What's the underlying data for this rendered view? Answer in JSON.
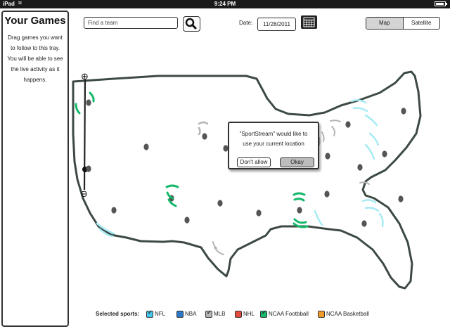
{
  "status_bar": {
    "carrier": "iPad",
    "time": "9:24 PM"
  },
  "tray": {
    "title": "Your Games",
    "description": "Drag games you want to follow to this tray. You will be able to see the live activity as it happens."
  },
  "toolbar": {
    "search_placeholder": "Find a team",
    "date_label": "Date:",
    "date_value": "11/28/2011",
    "map_label": "Map",
    "satellite_label": "Satellite",
    "active_view": "Map"
  },
  "zoom": {
    "plus": "⊕",
    "minus": "⊖"
  },
  "dialog": {
    "message_line1": "\"SportStream\" would like to",
    "message_line2": "use your current location",
    "deny_label": "Don't allow",
    "ok_label": "Okay"
  },
  "sports_filter": {
    "label": "Selected sports:",
    "items": [
      {
        "name": "NFL",
        "color": "#43c9f0",
        "checked": true
      },
      {
        "name": "NBA",
        "color": "#2b78c8",
        "checked": false
      },
      {
        "name": "MLB",
        "color": "#b5b5b5",
        "checked": true
      },
      {
        "name": "NHL",
        "color": "#e24a3b",
        "checked": false
      },
      {
        "name": "NCAA Footbball",
        "color": "#13b86b",
        "checked": true
      },
      {
        "name": "NCAA Basketball",
        "color": "#f09a2a",
        "checked": false
      }
    ]
  },
  "colors": {
    "nfl": "#43c9f0",
    "mlb": "#b5b5b5",
    "ncaa_football": "#13b86b",
    "ink": "#333333",
    "map_border": "#3d4a44"
  }
}
